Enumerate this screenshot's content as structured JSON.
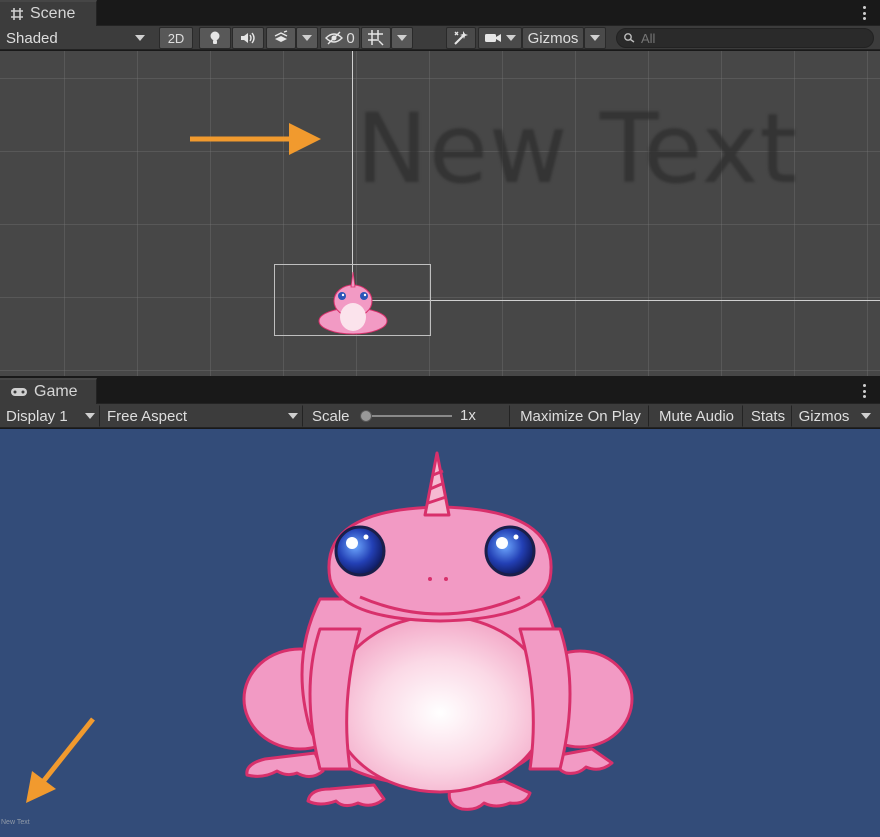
{
  "scene": {
    "tab_label": "Scene",
    "shading_mode": "Shaded",
    "mode_2d_label": "2D",
    "hidden_count": "0",
    "gizmos_label": "Gizmos",
    "search_placeholder": "All",
    "world_text": "New Text"
  },
  "game": {
    "tab_label": "Game",
    "display": "Display 1",
    "aspect": "Free Aspect",
    "scale_label": "Scale",
    "scale_value": "1x",
    "scale_fraction": 0.0,
    "maximize_label": "Maximize On Play",
    "mute_label": "Mute Audio",
    "stats_label": "Stats",
    "gizmos_label": "Gizmos",
    "ui_text": "New Text"
  },
  "colors": {
    "accent_arrow": "#f19a2e",
    "game_background": "#334c79",
    "scene_background": "#474747",
    "frog_pink": "#f29ac4",
    "frog_outline": "#d8306b"
  },
  "icons": [
    "scene-grid-icon",
    "lightbulb-icon",
    "audio-icon",
    "effects-icon",
    "visibility-icon",
    "grid-snap-icon",
    "tools-icon",
    "camera-icon",
    "search-icon",
    "gamepad-icon",
    "kebab-menu-icon"
  ]
}
